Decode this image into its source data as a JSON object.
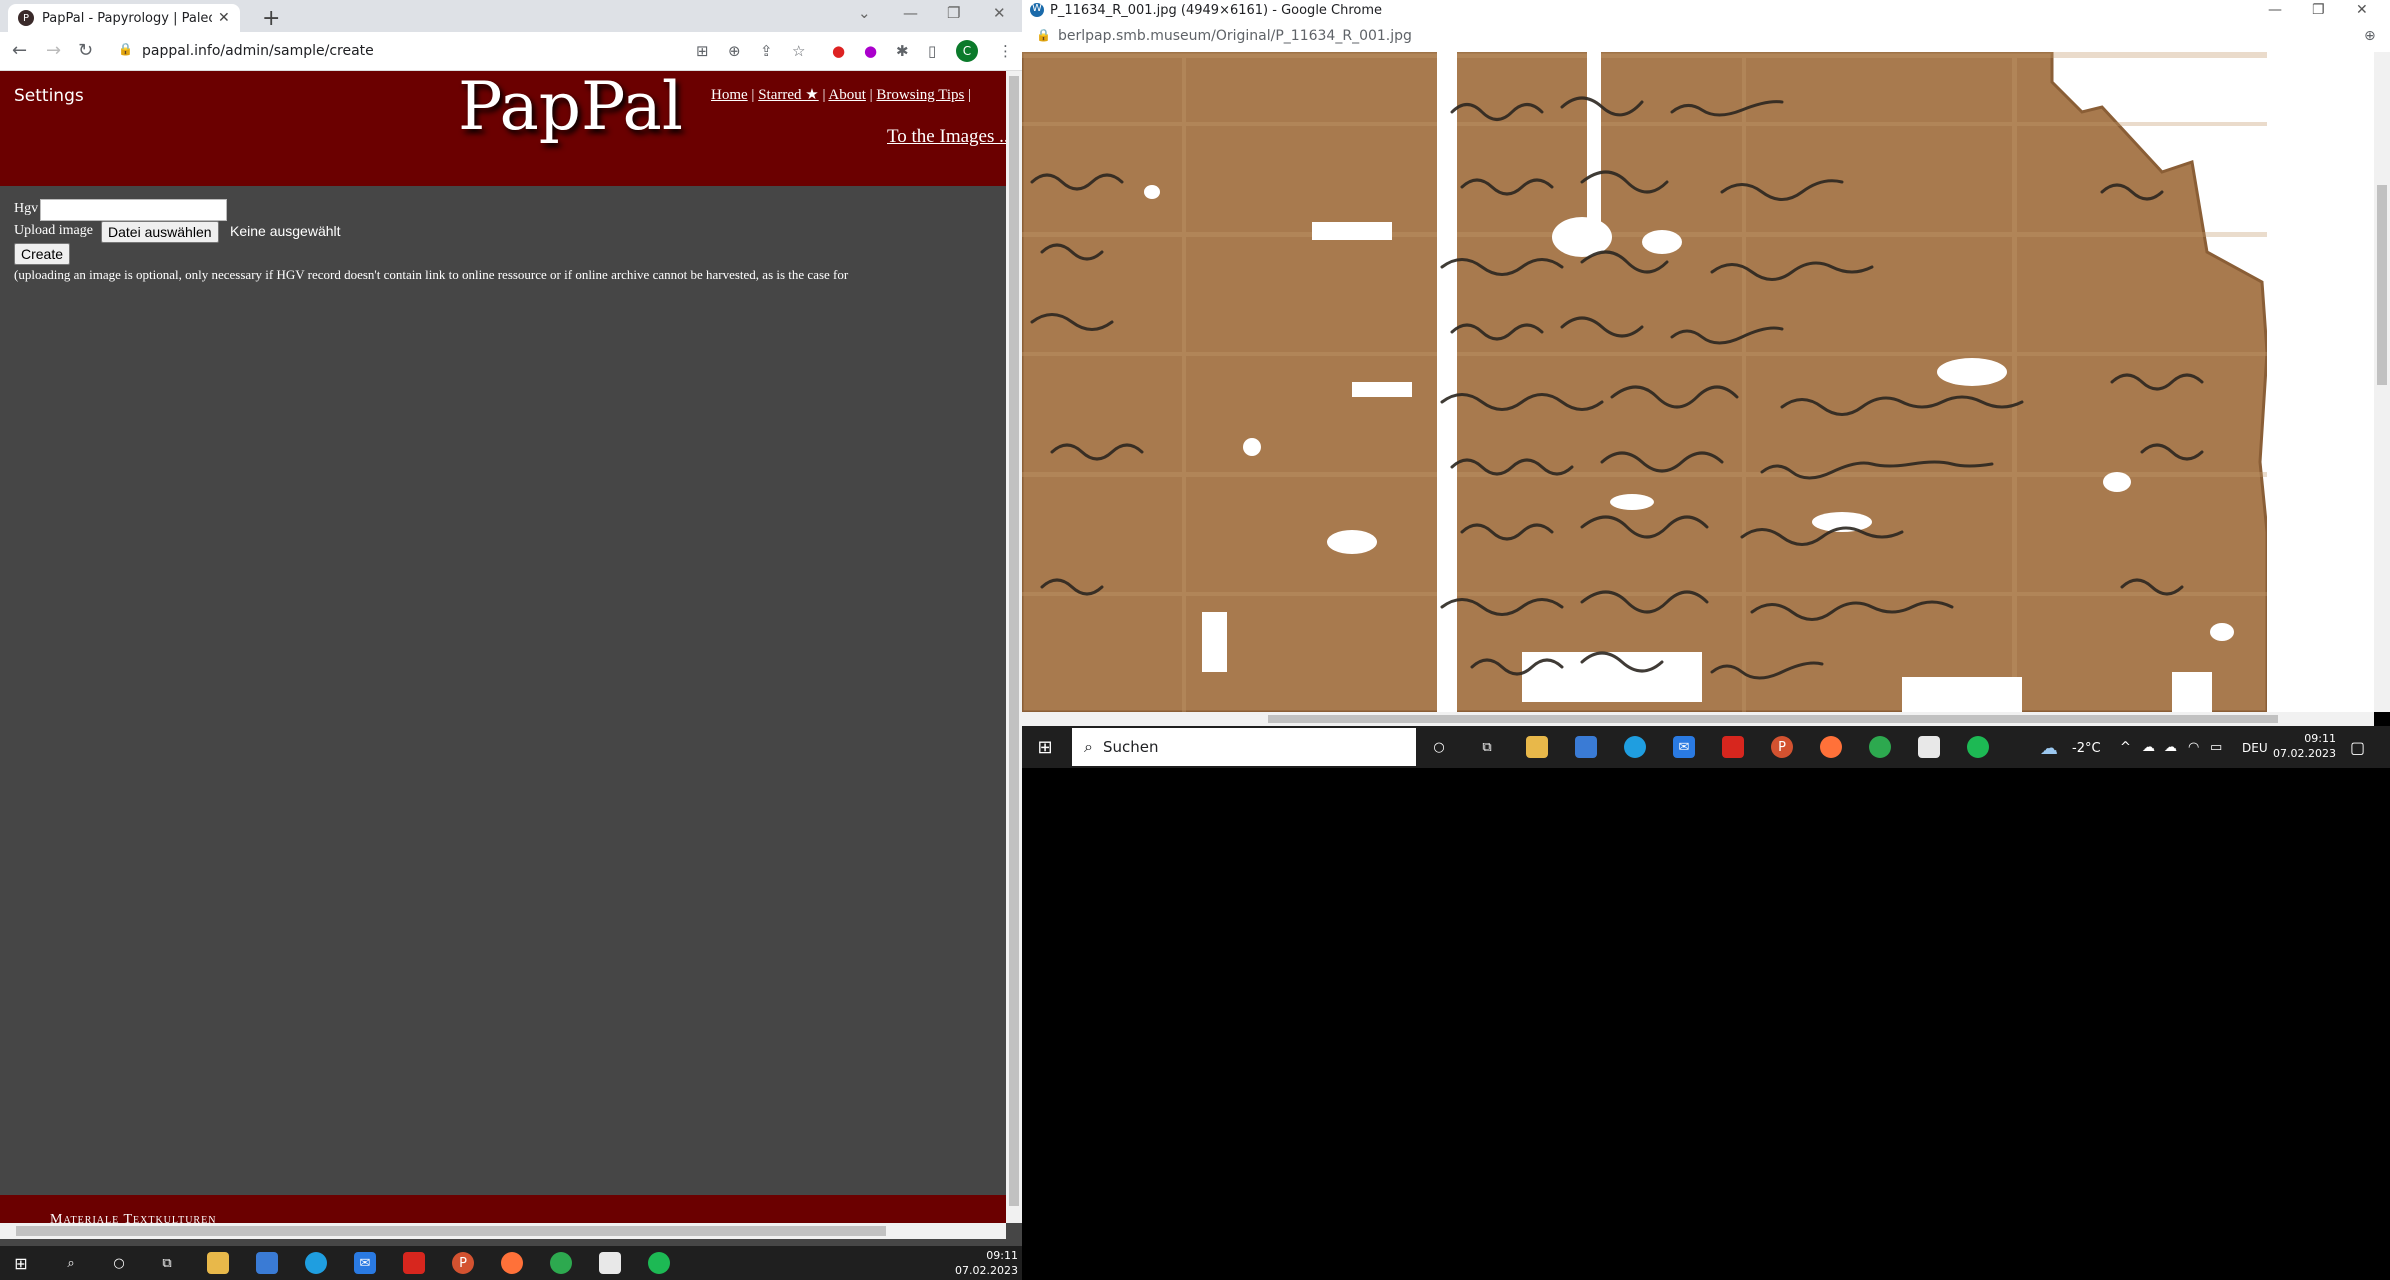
{
  "left_window": {
    "tab_title": "PapPal - Papyrology | Paleographic",
    "url": "pappal.info/admin/sample/create",
    "header": {
      "settings": "Settings",
      "logo": "PapPal",
      "nav": [
        "Home",
        "Starred ★",
        "About",
        "Browsing Tips"
      ],
      "nav_sep": "|",
      "to_images": "To the Images ..."
    },
    "form": {
      "hgv_label": "Hgv",
      "hgv_value": "",
      "upload_label": "Upload image",
      "choose_file_button": "Datei auswählen",
      "no_file_selected": "Keine ausgewählt",
      "create_button": "Create",
      "note": "(uploading an image is optional, only necessary if HGV record doesn't contain link to online ressource or if online archive cannot be harvested, as is the case for"
    },
    "footer_text": "Materiale Textkulturen",
    "taskbar": {
      "time": "09:11",
      "date": "07.02.2023"
    }
  },
  "right_window": {
    "title": "P_11634_R_001.jpg (4949×6161) - Google Chrome",
    "url": "berlpap.smb.museum/Original/P_11634_R_001.jpg",
    "image_alt": "P_11634_R_001 papyrus fragment",
    "taskbar": {
      "search_placeholder": "Suchen",
      "weather": "-2°C",
      "language": "DEU",
      "time": "09:11",
      "date": "07.02.2023"
    }
  },
  "colors": {
    "header_bg": "#6b0000",
    "page_bg": "#464646",
    "papyrus": "#a87a4e",
    "ink": "#2b2620",
    "taskbar": "#1f1f1f"
  },
  "icons": [
    "back-icon",
    "forward-icon",
    "reload-icon",
    "lock-icon",
    "translate-icon",
    "zoom-icon",
    "share-icon",
    "star-icon",
    "extensions-icon",
    "sidebar-icon",
    "menu-icon",
    "windows-start-icon",
    "search-icon",
    "cortana-icon",
    "task-view-icon",
    "file-explorer-icon",
    "store-icon",
    "edge-icon",
    "mail-icon",
    "acrobat-icon",
    "powerpoint-icon",
    "firefox-icon",
    "chrome-icon",
    "notes-icon",
    "spotify-icon",
    "weather-icon",
    "notification-icon"
  ]
}
